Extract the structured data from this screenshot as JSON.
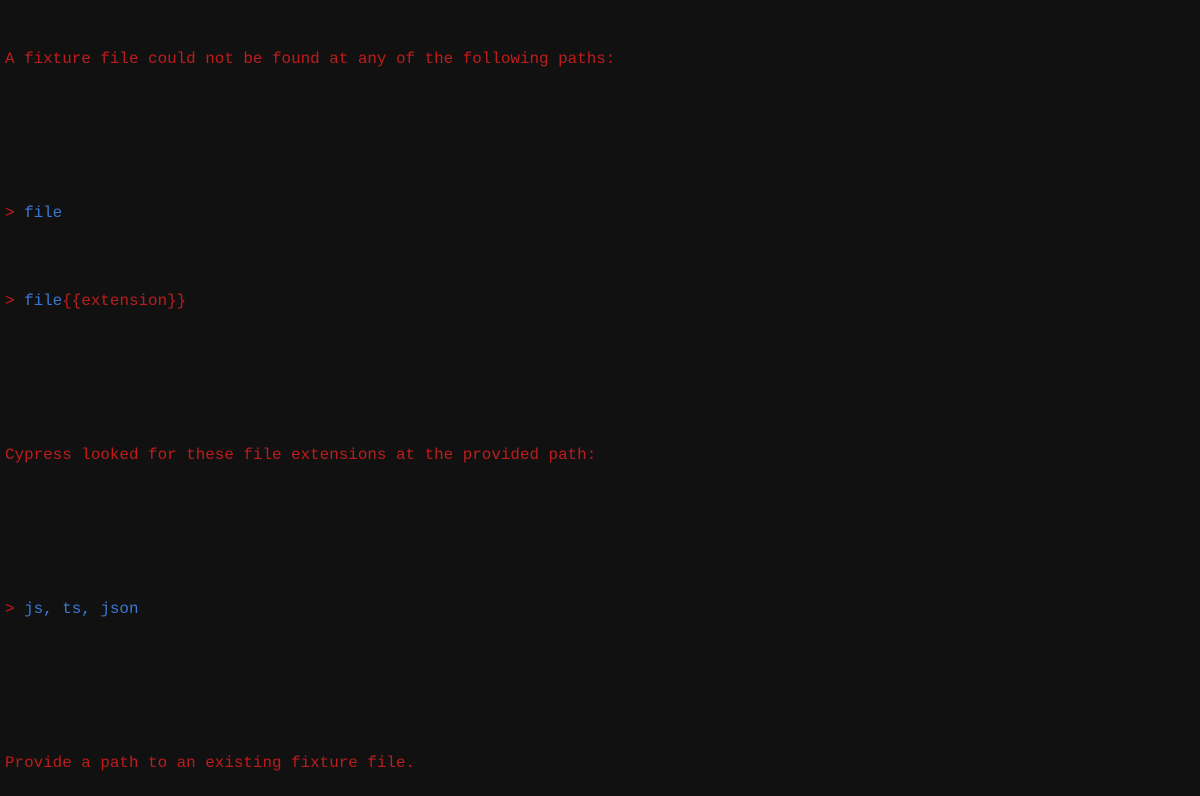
{
  "colors": {
    "background": "#111111",
    "error_text": "#c01c1c",
    "value_text": "#3b78d4"
  },
  "output": {
    "heading": "A fixture file could not be found at any of the following paths:",
    "prompt": "> ",
    "paths": [
      {
        "name": "file",
        "suffix": ""
      },
      {
        "name": "file",
        "suffix": "{{extension}}"
      }
    ],
    "extensions_heading": "Cypress looked for these file extensions at the provided path:",
    "extensions": "js, ts, json",
    "footer": "Provide a path to an existing fixture file."
  }
}
